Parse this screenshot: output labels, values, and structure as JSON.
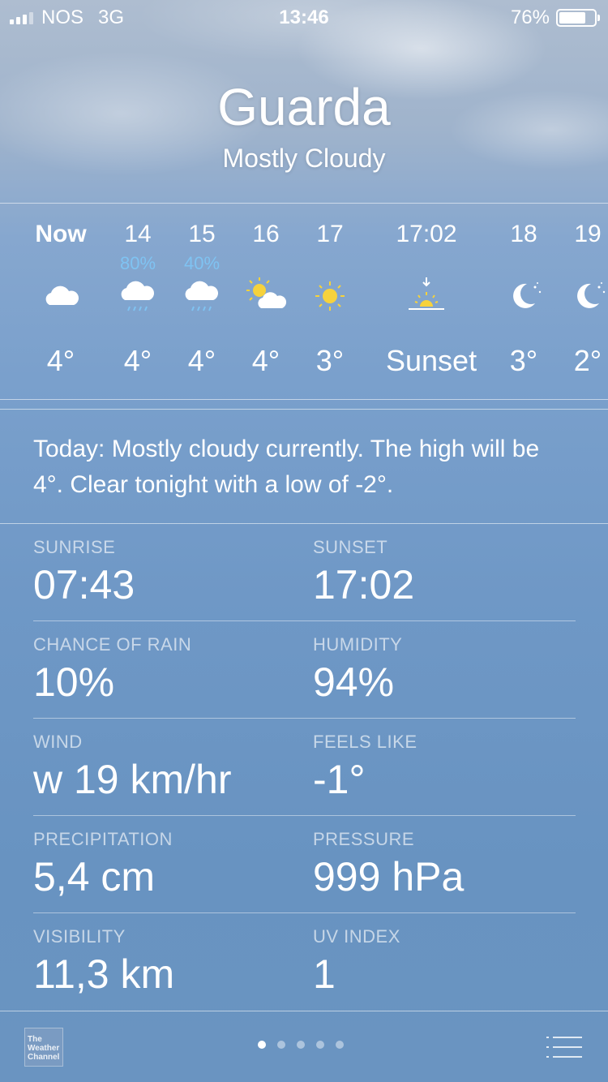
{
  "status_bar": {
    "carrier": "NOS",
    "network": "3G",
    "time": "13:46",
    "battery_text": "76%",
    "battery_level": 0.76
  },
  "header": {
    "city": "Guarda",
    "condition": "Mostly Cloudy"
  },
  "hourly": [
    {
      "label": "Now",
      "chance": "",
      "icon": "cloud-icon",
      "temp": "4°"
    },
    {
      "label": "14",
      "chance": "80%",
      "icon": "rain-cloud-icon",
      "temp": "4°"
    },
    {
      "label": "15",
      "chance": "40%",
      "icon": "rain-cloud-icon",
      "temp": "4°"
    },
    {
      "label": "16",
      "chance": "",
      "icon": "partly-sunny-icon",
      "temp": "4°"
    },
    {
      "label": "17",
      "chance": "",
      "icon": "sun-icon",
      "temp": "3°"
    },
    {
      "label": "17:02",
      "chance": "",
      "icon": "sunset-icon",
      "temp": "Sunset"
    },
    {
      "label": "18",
      "chance": "",
      "icon": "moon-icon",
      "temp": "3°"
    },
    {
      "label": "19",
      "chance": "",
      "icon": "moon-icon",
      "temp": "2°"
    }
  ],
  "summary": "Today: Mostly cloudy currently. The high will be 4°. Clear tonight with a low of -2°.",
  "details": [
    {
      "left": {
        "label": "SUNRISE",
        "value": "07:43"
      },
      "right": {
        "label": "SUNSET",
        "value": "17:02"
      }
    },
    {
      "left": {
        "label": "CHANCE OF RAIN",
        "value": "10%"
      },
      "right": {
        "label": "HUMIDITY",
        "value": "94%"
      }
    },
    {
      "left": {
        "label": "WIND",
        "value": "w 19 km/hr"
      },
      "right": {
        "label": "FEELS LIKE",
        "value": "-1°"
      }
    },
    {
      "left": {
        "label": "PRECIPITATION",
        "value": "5,4 cm"
      },
      "right": {
        "label": "PRESSURE",
        "value": "999 hPa"
      }
    },
    {
      "left": {
        "label": "VISIBILITY",
        "value": "11,3 km"
      },
      "right": {
        "label": "UV INDEX",
        "value": "1"
      }
    }
  ],
  "footer": {
    "logo_text": "The Weather Channel",
    "page_count": 5,
    "active_page": 0
  },
  "colors": {
    "chance_blue": "#7fc3f2",
    "sun_yellow": "#f6d23c"
  }
}
